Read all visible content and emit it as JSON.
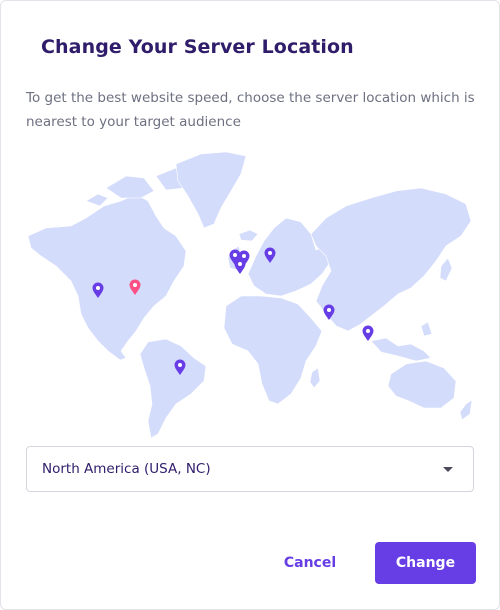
{
  "dialog": {
    "title": "Change Your Server Location",
    "description": "To get the best website speed, choose the server location which is nearest to your target audience"
  },
  "map": {
    "land_color": "#d4dcfc",
    "pin_default_color": "#673de6",
    "pin_selected_color": "#fc5185",
    "pins": [
      {
        "name": "pin-usa-west",
        "selected": false
      },
      {
        "name": "pin-usa-nc",
        "selected": true
      },
      {
        "name": "pin-brazil",
        "selected": false
      },
      {
        "name": "pin-uk",
        "selected": false
      },
      {
        "name": "pin-netherlands",
        "selected": false
      },
      {
        "name": "pin-france",
        "selected": false
      },
      {
        "name": "pin-lithuania",
        "selected": false
      },
      {
        "name": "pin-india",
        "selected": false
      },
      {
        "name": "pin-singapore",
        "selected": false
      }
    ]
  },
  "location_select": {
    "value": "North America (USA, NC)"
  },
  "buttons": {
    "cancel": "Cancel",
    "change": "Change"
  },
  "colors": {
    "accent": "#673de6",
    "title": "#2f1c6a",
    "text_muted": "#6d7081"
  }
}
